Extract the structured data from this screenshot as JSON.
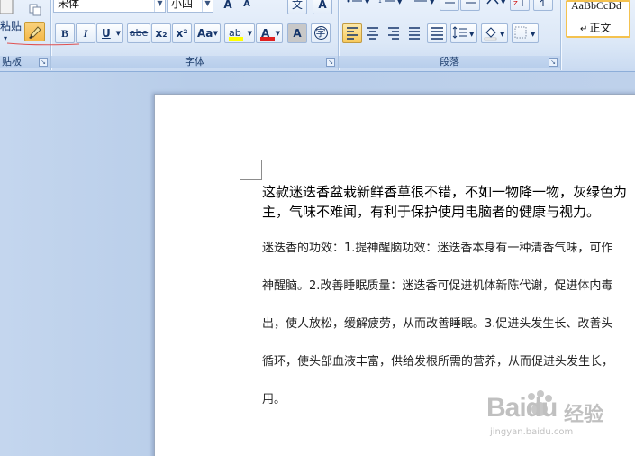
{
  "clipboard": {
    "paste_label": "粘贴",
    "group_label": "贴板",
    "dropdown_glyph": "▾"
  },
  "font": {
    "group_label": "字体",
    "font_name": "宋体",
    "font_size": "小四",
    "buttons": {
      "bold": "B",
      "italic": "I",
      "underline": "U",
      "strikethrough": "abe",
      "subscript": "x₂",
      "superscript": "x²",
      "change_case": "Aa",
      "highlight": "ab",
      "font_color": "A",
      "char_shading": "A",
      "enclose_char": "字",
      "grow_font": "A",
      "shrink_font": "A",
      "phonetic": "文",
      "clear_format": "A"
    }
  },
  "paragraph": {
    "group_label": "段落"
  },
  "styles": {
    "sample": "AaBbCcDd",
    "name": "正文",
    "mark": "↵"
  },
  "document": {
    "paragraph1": [
      "这款迷迭香盆栽新鲜香草很不错，不如一物降一物，灰绿色为",
      "主，气味不难闻，有利于保护使用电脑者的健康与视力。"
    ],
    "paragraph2": [
      "迷迭香的功效：1.提神醒脑功效：迷迭香本身有一种清香气味，可作",
      "神醒脑。2.改善睡眠质量：迷迭香可促进机体新陈代谢，促进体内毒",
      "出，使人放松，缓解疲劳，从而改善睡眠。3.促进头发生长、改善头",
      "循环，使头部血液丰富，供给发根所需的营养，从而促进头发生长，",
      "用。"
    ]
  },
  "watermark": {
    "brand": "Baidu",
    "cn": "经验",
    "url": "jingyan.baidu.com"
  },
  "colors": {
    "font_color_bar": "#e02020",
    "highlight_bar": "#ffff00",
    "active_border": "#f4c24f"
  }
}
